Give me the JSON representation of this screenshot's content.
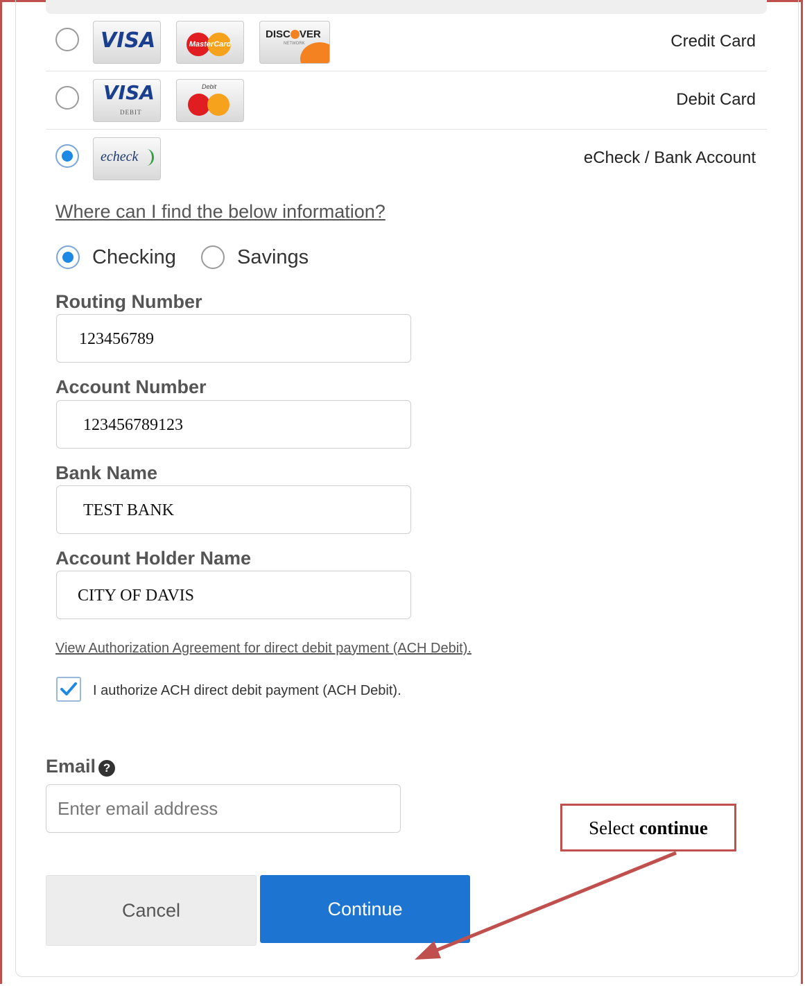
{
  "payment_methods": [
    {
      "label": "Credit Card",
      "selected": false,
      "logos": [
        "visa-logo",
        "mastercard-logo",
        "discover-logo"
      ]
    },
    {
      "label": "Debit Card",
      "selected": false,
      "logos": [
        "visa-debit-logo",
        "debit-mastercard-logo"
      ]
    },
    {
      "label": "eCheck / Bank Account",
      "selected": true,
      "logos": [
        "echeck-logo"
      ]
    }
  ],
  "logos": {
    "visa": "VISA",
    "visa_debit_sub": "DEBIT",
    "mastercard": "MasterCard",
    "debit_top": "Debit",
    "discover_a": "DISC",
    "discover_b": "VER",
    "discover_net": "NETWORK",
    "echeck": "echeck"
  },
  "help_link": "Where can I find the below information?",
  "account_type": {
    "options": [
      "Checking",
      "Savings"
    ],
    "selected": "Checking"
  },
  "fields": {
    "routing": {
      "label": "Routing Number",
      "value": "123456789"
    },
    "account": {
      "label": "Account Number",
      "value": "123456789123"
    },
    "bank": {
      "label": "Bank Name",
      "value": "TEST BANK"
    },
    "holder": {
      "label": "Account Holder Name",
      "value": "CITY OF DAVIS"
    }
  },
  "authorization": {
    "link": "View Authorization Agreement for direct debit payment (ACH Debit).",
    "checkbox_label": "I authorize ACH direct debit payment (ACH Debit).",
    "checked": true
  },
  "email": {
    "label": "Email",
    "placeholder": "Enter email address",
    "value": ""
  },
  "buttons": {
    "cancel": "Cancel",
    "continue": "Continue"
  },
  "callout": {
    "prefix": "Select ",
    "emphasis": "continue"
  },
  "colors": {
    "accent_blue": "#1e74d1",
    "radio_blue": "#1e88e5",
    "annotation_red": "#c0504d"
  }
}
